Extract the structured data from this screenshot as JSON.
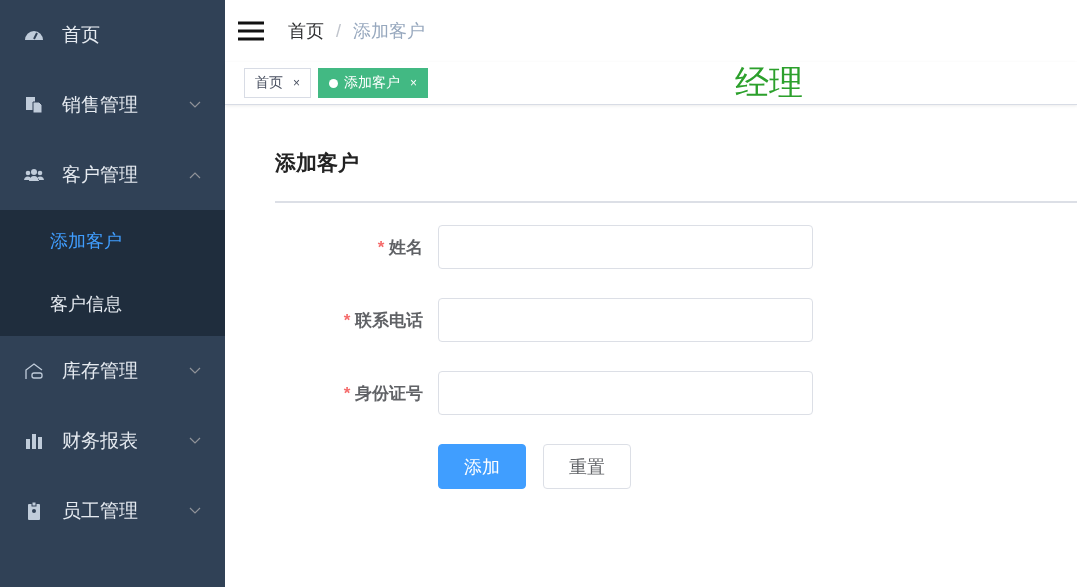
{
  "sidebar": {
    "items": [
      {
        "label": "首页",
        "kind": "link"
      },
      {
        "label": "销售管理",
        "kind": "submenu",
        "expanded": false
      },
      {
        "label": "客户管理",
        "kind": "submenu",
        "expanded": true,
        "children": [
          {
            "label": "添加客户",
            "selected": true
          },
          {
            "label": "客户信息",
            "selected": false
          }
        ]
      },
      {
        "label": "库存管理",
        "kind": "submenu",
        "expanded": false
      },
      {
        "label": "财务报表",
        "kind": "submenu",
        "expanded": false
      },
      {
        "label": "员工管理",
        "kind": "submenu",
        "expanded": false
      }
    ]
  },
  "breadcrumb": [
    "首页",
    "添加客户"
  ],
  "breadcrumb_separator": "/",
  "tabs": [
    {
      "label": "首页",
      "close": "×",
      "selected": false
    },
    {
      "label": "添加客户",
      "close": "×",
      "selected": true
    }
  ],
  "role": "经理",
  "form": {
    "title": "添加客户",
    "fields": [
      {
        "label": "姓名",
        "required": true,
        "required_mark": "*"
      },
      {
        "label": "联系电话",
        "required": true,
        "required_mark": "*"
      },
      {
        "label": "身份证号",
        "required": true,
        "required_mark": "*"
      }
    ],
    "buttons": [
      {
        "label": "添加",
        "kind": "primary"
      },
      {
        "label": "重置",
        "kind": "default"
      }
    ]
  }
}
